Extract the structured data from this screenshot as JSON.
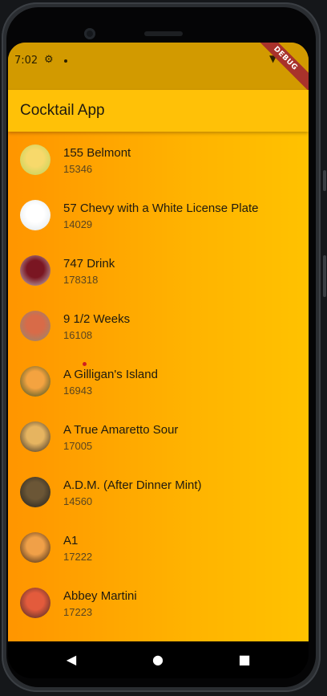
{
  "status_bar": {
    "time": "7:02",
    "settings_icon": "gear-icon",
    "wifi_icon": "wifi-icon",
    "banner": "DEBUG"
  },
  "app_bar": {
    "title": "Cocktail App"
  },
  "drinks": [
    {
      "name": "155 Belmont",
      "id": "15346",
      "thumb_colors": [
        "#f7d96b",
        "#b7d35a"
      ]
    },
    {
      "name": "57 Chevy with a White License Plate",
      "id": "14029",
      "thumb_colors": [
        "#ffffff",
        "#dfe6ea"
      ]
    },
    {
      "name": "747 Drink",
      "id": "178318",
      "thumb_colors": [
        "#7a1622",
        "#c7c3c8"
      ]
    },
    {
      "name": "9 1/2 Weeks",
      "id": "16108",
      "thumb_colors": [
        "#d86b48",
        "#8a8e78"
      ]
    },
    {
      "name": "A Gilligan's Island",
      "id": "16943",
      "thumb_colors": [
        "#f4a340",
        "#2e4a22"
      ]
    },
    {
      "name": "A True Amaretto Sour",
      "id": "17005",
      "thumb_colors": [
        "#e6b460",
        "#2a2320"
      ]
    },
    {
      "name": "A.D.M. (After Dinner Mint)",
      "id": "14560",
      "thumb_colors": [
        "#6b5636",
        "#1d1d1a"
      ]
    },
    {
      "name": "A1",
      "id": "17222",
      "thumb_colors": [
        "#f0a048",
        "#2a1a10"
      ]
    },
    {
      "name": "Abbey Martini",
      "id": "17223",
      "thumb_colors": [
        "#e35b3c",
        "#3a2524"
      ]
    }
  ],
  "nav": {
    "back": "◀",
    "home": "●",
    "recents": "■"
  }
}
